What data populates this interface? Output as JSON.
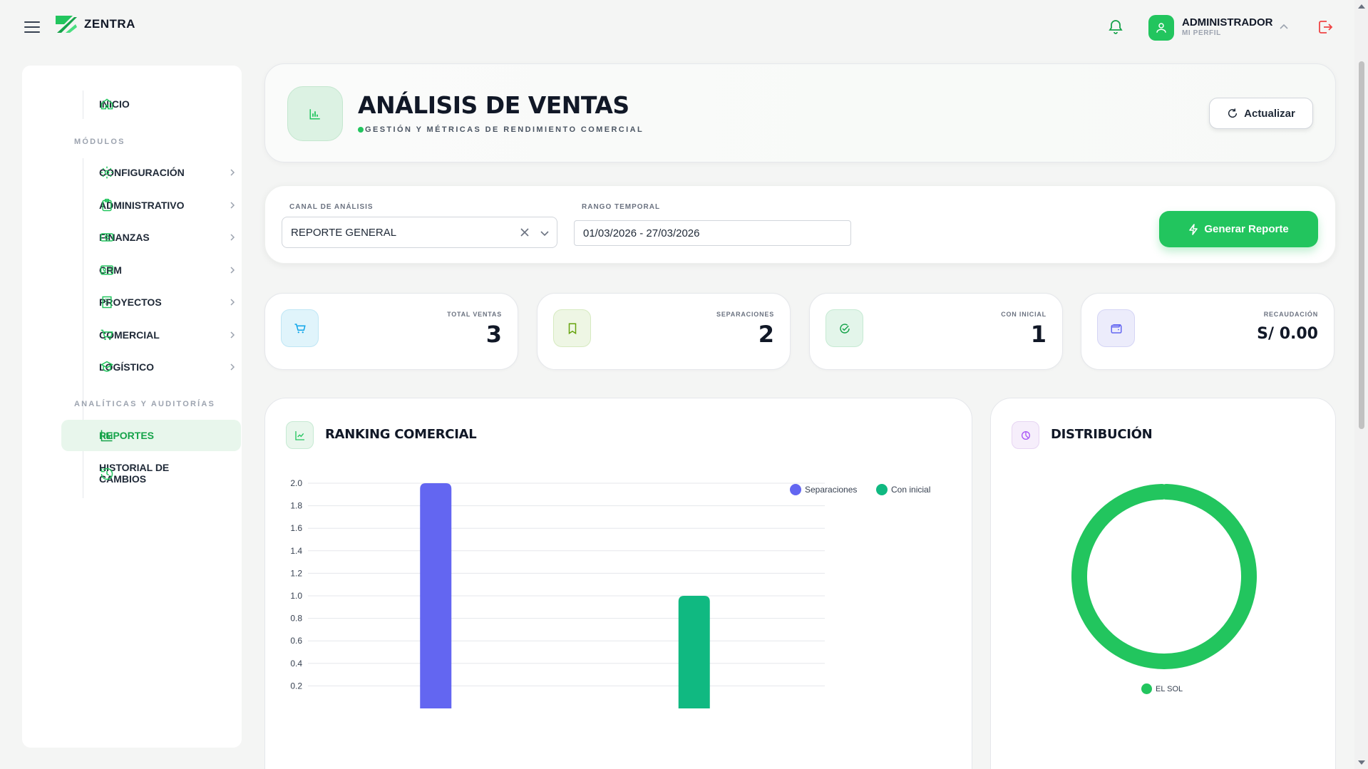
{
  "app": {
    "brand": "ZENTRA"
  },
  "user": {
    "name": "ADMINISTRADOR",
    "subtitle": "MI PERFIL"
  },
  "sidebar": {
    "home": {
      "label": "INICIO",
      "icon": "home-icon"
    },
    "modules_label": "MÓDULOS",
    "modules": [
      {
        "label": "CONFIGURACIÓN",
        "icon": "gear-icon"
      },
      {
        "label": "ADMINISTRATIVO",
        "icon": "clipboard-icon"
      },
      {
        "label": "FINANZAS",
        "icon": "money-icon"
      },
      {
        "label": "CRM",
        "icon": "id-card-icon"
      },
      {
        "label": "PROYECTOS",
        "icon": "building-icon"
      },
      {
        "label": "COMERCIAL",
        "icon": "cart-icon"
      },
      {
        "label": "LOGÍSTICO",
        "icon": "box-icon"
      }
    ],
    "analytics_label": "ANALÍTICAS Y AUDITORÍAS",
    "analytics": [
      {
        "label": "REPORTES",
        "icon": "bar-chart-icon",
        "active": true
      },
      {
        "label": "HISTORIAL DE CAMBIOS",
        "icon": "history-icon"
      }
    ]
  },
  "header": {
    "title": "ANÁLISIS DE VENTAS",
    "subtitle": "GESTIÓN Y MÉTRICAS DE RENDIMIENTO COMERCIAL",
    "refresh_label": "Actualizar"
  },
  "filters": {
    "channel_label": "CANAL DE ANÁLISIS",
    "channel_value": "REPORTE GENERAL",
    "range_label": "RANGO TEMPORAL",
    "range_value": "01/03/2026 - 27/03/2026",
    "generate_label": "Generar Reporte"
  },
  "stats": [
    {
      "label": "TOTAL VENTAS",
      "value": "3",
      "icon": "cart-icon",
      "color": "#0ea5e9"
    },
    {
      "label": "SEPARACIONES",
      "value": "2",
      "icon": "bookmark-icon",
      "color": "#65a30d"
    },
    {
      "label": "CON INICIAL",
      "value": "1",
      "icon": "check-circle-icon",
      "color": "#16a34a"
    },
    {
      "label": "RECAUDACIÓN",
      "value": "S/ 0.00",
      "icon": "wallet-icon",
      "color": "#6366f1"
    }
  ],
  "ranking": {
    "title": "RANKING COMERCIAL"
  },
  "distribution": {
    "title": "DISTRIBUCIÓN"
  },
  "colors": {
    "accent": "#22c55e",
    "separaciones": "#6366f1",
    "con_inicial": "#10b981"
  },
  "chart_data": [
    {
      "type": "bar",
      "title": "RANKING COMERCIAL",
      "categories": [
        "",
        ""
      ],
      "series": [
        {
          "name": "Separaciones",
          "color": "#6366f1",
          "values": [
            2,
            0
          ]
        },
        {
          "name": "Con inicial",
          "color": "#10b981",
          "values": [
            0,
            1
          ]
        }
      ],
      "y_ticks": [
        "2.0",
        "1.8",
        "1.6",
        "1.4",
        "1.2",
        "1.0",
        "0.8",
        "0.6",
        "0.4",
        "0.2"
      ],
      "ylim": [
        0,
        2.0
      ],
      "grid": true,
      "legend": "top-right"
    },
    {
      "type": "pie",
      "title": "DISTRIBUCIÓN",
      "labels": [
        "EL SOL"
      ],
      "values": [
        1
      ],
      "colors": [
        "#22c55e"
      ],
      "legend": "bottom"
    }
  ]
}
